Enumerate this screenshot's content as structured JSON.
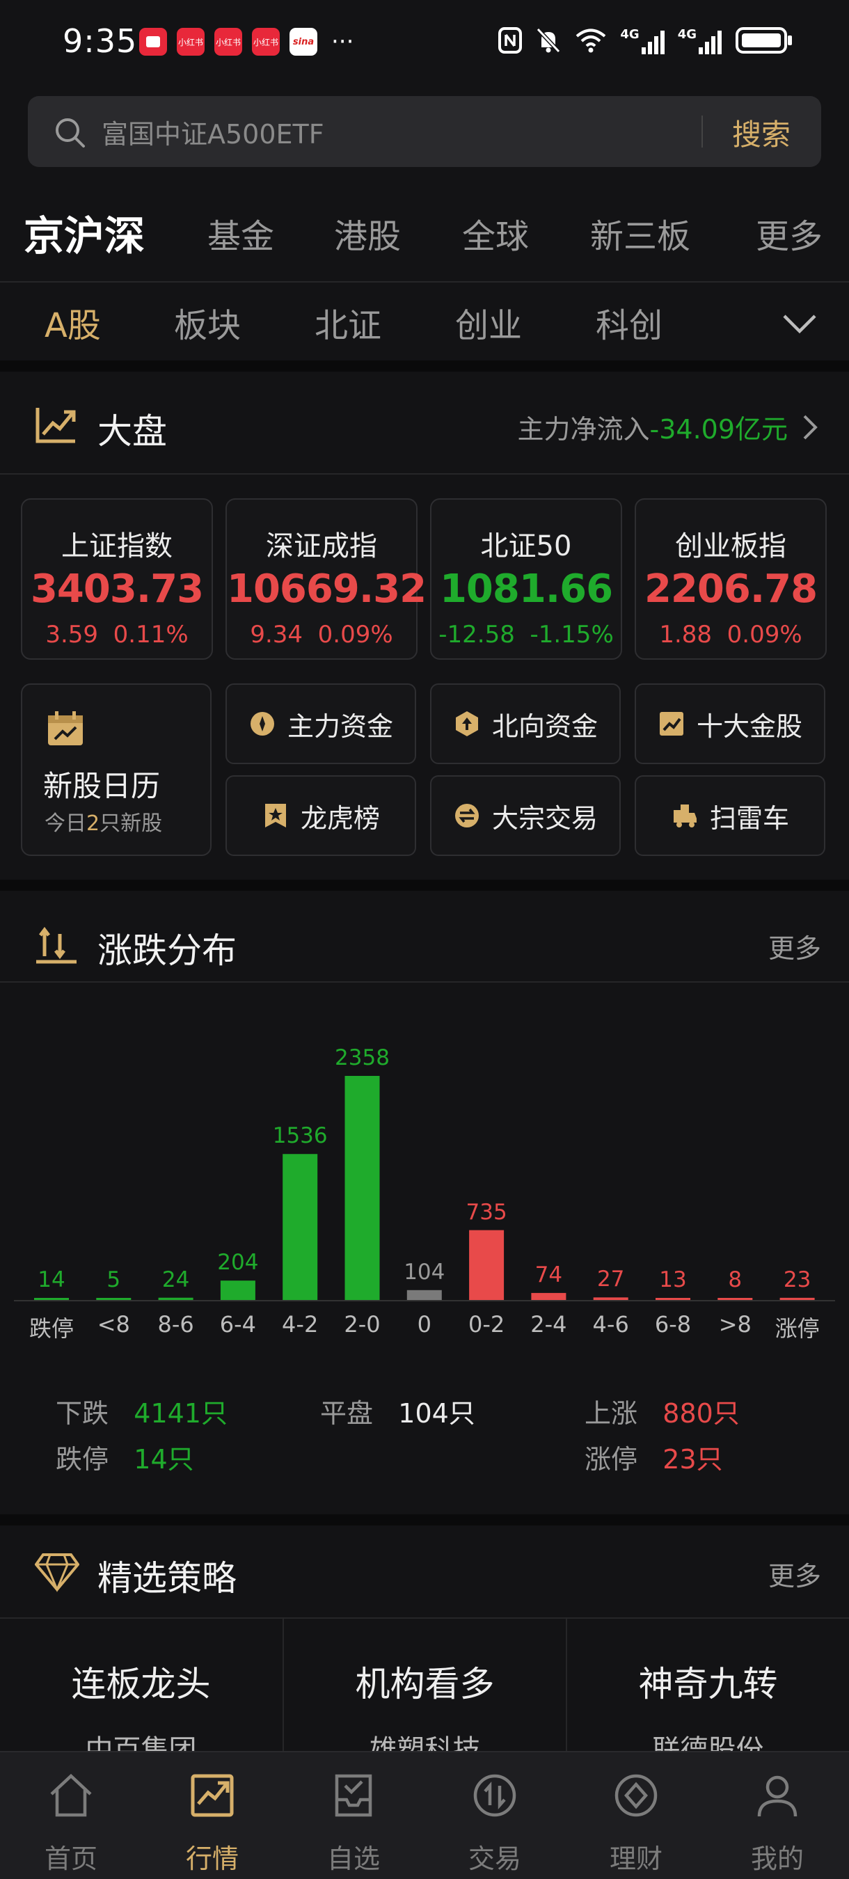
{
  "status_bar": {
    "time": "9:35",
    "apps": [
      "小红书",
      "小红书",
      "小红书"
    ],
    "sina": "sina",
    "more": "···",
    "network_a": "4G",
    "network_b": "4G"
  },
  "search": {
    "placeholder": "富国中证A500ETF",
    "button": "搜索"
  },
  "main_tabs": [
    {
      "label": "京沪深",
      "active": true
    },
    {
      "label": "基金"
    },
    {
      "label": "港股"
    },
    {
      "label": "全球"
    },
    {
      "label": "新三板"
    },
    {
      "label": "更多"
    }
  ],
  "sub_tabs": [
    {
      "label": "A股",
      "active": true
    },
    {
      "label": "板块"
    },
    {
      "label": "北证"
    },
    {
      "label": "创业"
    },
    {
      "label": "科创"
    }
  ],
  "market": {
    "title": "大盘",
    "flow_label": "主力净流入",
    "flow_value": "-34.09亿元"
  },
  "indices": [
    {
      "name": "上证指数",
      "value": "3403.73",
      "change": "3.59",
      "pct": "0.11%",
      "dir": "up"
    },
    {
      "name": "深证成指",
      "value": "10669.32",
      "change": "9.34",
      "pct": "0.09%",
      "dir": "up"
    },
    {
      "name": "北证50",
      "value": "1081.66",
      "change": "-12.58",
      "pct": "-1.15%",
      "dir": "down"
    },
    {
      "name": "创业板指",
      "value": "2206.78",
      "change": "1.88",
      "pct": "0.09%",
      "dir": "up"
    }
  ],
  "calendar": {
    "title": "新股日历",
    "sub_prefix": "今日",
    "sub_count": "2",
    "sub_suffix": "只新股"
  },
  "shortcuts": [
    {
      "label": "主力资金",
      "icon": "main-funds-icon"
    },
    {
      "label": "北向资金",
      "icon": "northbound-icon"
    },
    {
      "label": "十大金股",
      "icon": "gold-stock-icon"
    },
    {
      "label": "龙虎榜",
      "icon": "dragon-tiger-icon"
    },
    {
      "label": "大宗交易",
      "icon": "block-trade-icon"
    },
    {
      "label": "扫雷车",
      "icon": "minesweeper-icon"
    }
  ],
  "distribution": {
    "title": "涨跌分布",
    "more": "更多",
    "stats": {
      "down_label": "下跌",
      "down_value": "4141只",
      "limit_down_label": "跌停",
      "limit_down_value": "14只",
      "flat_label": "平盘",
      "flat_value": "104只",
      "up_label": "上涨",
      "up_value": "880只",
      "limit_up_label": "涨停",
      "limit_up_value": "23只"
    }
  },
  "chart_data": {
    "type": "bar",
    "categories": [
      "跌停",
      "<8",
      "8-6",
      "6-4",
      "4-2",
      "2-0",
      "0",
      "0-2",
      "2-4",
      "4-6",
      "6-8",
      ">8",
      "涨停"
    ],
    "values": [
      14,
      5,
      24,
      204,
      1536,
      2358,
      104,
      735,
      74,
      27,
      13,
      8,
      23
    ],
    "colors": [
      "#1fab2c",
      "#1fab2c",
      "#1fab2c",
      "#1fab2c",
      "#1fab2c",
      "#1fab2c",
      "#7a7a7a",
      "#e84a4a",
      "#e84a4a",
      "#e84a4a",
      "#e84a4a",
      "#e84a4a",
      "#e84a4a"
    ],
    "title": "",
    "xlabel": "",
    "ylabel": "",
    "ylim": [
      0,
      2358
    ]
  },
  "strategies": {
    "title": "精选策略",
    "more": "更多",
    "items": [
      {
        "name": "连板龙头",
        "stock": "中百集团"
      },
      {
        "name": "机构看多",
        "stock": "雄塑科技"
      },
      {
        "name": "神奇九转",
        "stock": "联德股份"
      }
    ]
  },
  "bottom_nav": [
    {
      "label": "首页",
      "icon": "home-icon"
    },
    {
      "label": "行情",
      "icon": "market-icon",
      "active": true
    },
    {
      "label": "自选",
      "icon": "watchlist-icon"
    },
    {
      "label": "交易",
      "icon": "trade-icon"
    },
    {
      "label": "理财",
      "icon": "wealth-icon"
    },
    {
      "label": "我的",
      "icon": "profile-icon"
    }
  ]
}
